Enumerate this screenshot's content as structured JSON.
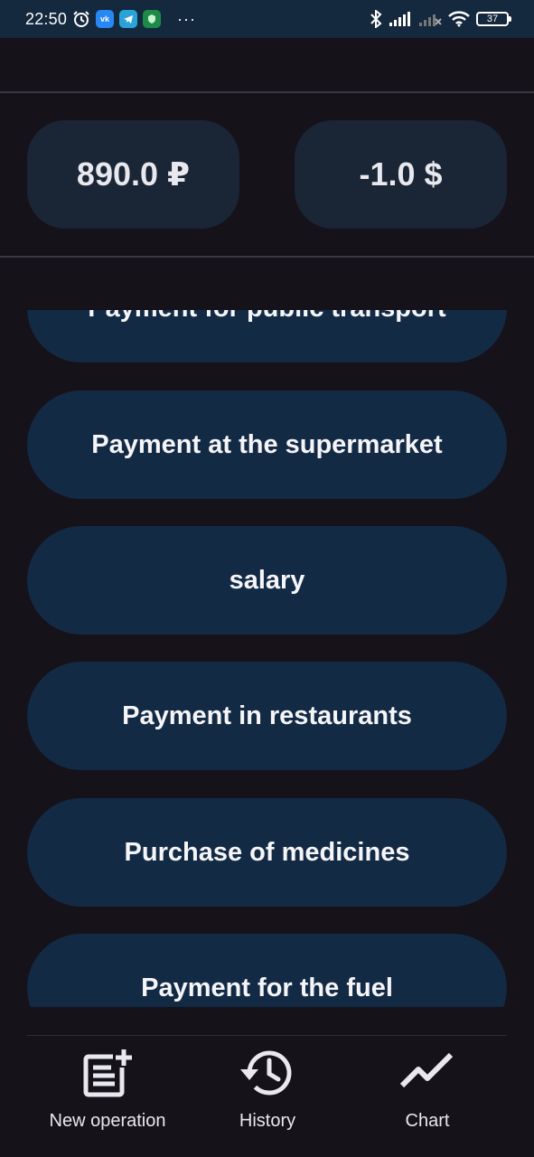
{
  "status_bar": {
    "time": "22:50",
    "app_icons": [
      "alarm-clock-icon",
      "vk-icon",
      "telegram-icon",
      "shield-app-icon"
    ],
    "vk_label": "vk",
    "more": "···",
    "right_icons": [
      "bluetooth-icon",
      "signal-icon",
      "signal-no-service-icon",
      "wifi-icon"
    ],
    "battery": "37"
  },
  "balances": {
    "rub": "890.0 ₽",
    "usd": "-1.0 $"
  },
  "operations": [
    {
      "label": "Payment for public transport"
    },
    {
      "label": "Payment at the supermarket"
    },
    {
      "label": "salary"
    },
    {
      "label": "Payment in restaurants"
    },
    {
      "label": "Purchase of medicines"
    },
    {
      "label": "Payment for the fuel"
    }
  ],
  "bottom_nav": {
    "items": [
      {
        "label": "New operation",
        "icon": "note-add-icon"
      },
      {
        "label": "History",
        "icon": "history-icon"
      },
      {
        "label": "Chart",
        "icon": "chart-line-icon"
      }
    ]
  },
  "colors": {
    "background": "#15121a",
    "status_bar": "#14283e",
    "card": "#1a2535",
    "button": "#132a45",
    "text": "#ffffff"
  }
}
